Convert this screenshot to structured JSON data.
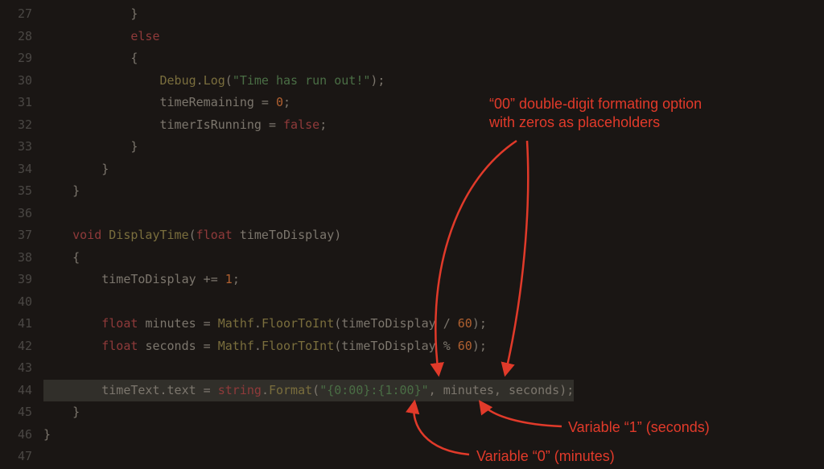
{
  "gutter": {
    "start": 27,
    "end": 47
  },
  "code": {
    "l27": "            }",
    "l28": {
      "t0": "            ",
      "kw": "else"
    },
    "l29": "            {",
    "l30": {
      "t0": "                ",
      "cls": "Debug",
      "dot": ".",
      "m": "Log",
      "p": "(",
      "s": "\"Time has run out!\"",
      "p2": ");"
    },
    "l31": {
      "t0": "                ",
      "id": "timeRemaining",
      " = ": true,
      "n": "0",
      "p": ";"
    },
    "l32": {
      "t0": "                ",
      "id": "timerIsRunning",
      " = ": true,
      "kw": "false",
      "p": ";"
    },
    "l33": "            }",
    "l34": "        }",
    "l35": "    }",
    "l36": "",
    "l37": {
      "t0": "    ",
      "kw": "void",
      "sp": " ",
      "m": "DisplayTime",
      "p": "(",
      "ty": "float",
      "sp2": " ",
      "id": "timeToDisplay",
      "p2": ")"
    },
    "l38": "    {",
    "l39": {
      "t0": "        ",
      "id": "timeToDisplay",
      "op": " += ",
      "n": "1",
      "p": ";"
    },
    "l40": "",
    "l41": {
      "t0": "        ",
      "ty": "float",
      "sp": " ",
      "id": "minutes",
      "op": " = ",
      "cls": "Mathf",
      "dot": ".",
      "m": "FloorToInt",
      "p": "(",
      "arg": "timeToDisplay / ",
      "n": "60",
      "p2": ");"
    },
    "l42": {
      "t0": "        ",
      "ty": "float",
      "sp": " ",
      "id": "seconds",
      "op": " = ",
      "cls": "Mathf",
      "dot": ".",
      "m": "FloorToInt",
      "p": "(",
      "arg": "timeToDisplay % ",
      "n": "60",
      "p2": ");"
    },
    "l43": "",
    "l44": {
      "t0": "        ",
      "id": "timeText",
      "dot": ".",
      "prop": "text",
      "op": " = ",
      "kw": "string",
      "dot2": ".",
      "m": "Format",
      "p": "(",
      "s": "\"{0:00}:{1:00}\"",
      "c": ", minutes, seconds);"
    },
    "l45": "    }",
    "l46": "}",
    "l47": ""
  },
  "annotations": {
    "a1_line1": "“00” double-digit formating option",
    "a1_line2": "with zeros as placeholders",
    "a2": "Variable “1” (seconds)",
    "a3": "Variable “0” (minutes)"
  }
}
